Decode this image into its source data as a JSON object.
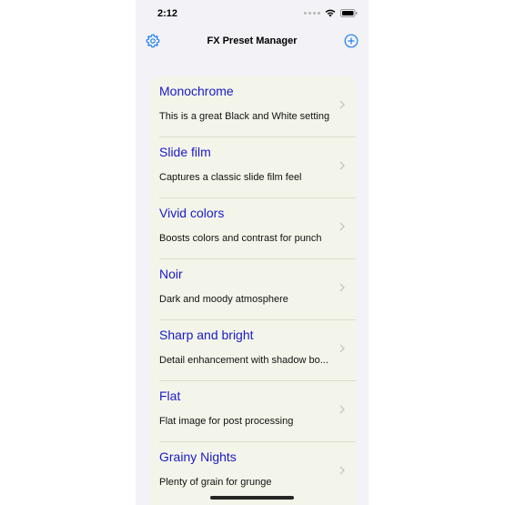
{
  "status": {
    "time": "2:12"
  },
  "nav": {
    "title": "FX Preset Manager",
    "settings_icon": "gear-icon",
    "add_icon": "plus-circle-icon"
  },
  "colors": {
    "accent": "#1a7ff0",
    "title_text": "#1a1ac8",
    "list_bg": "#f4f5ea"
  },
  "presets": [
    {
      "title": "Monochrome",
      "subtitle": "This is a great Black and White setting"
    },
    {
      "title": "Slide film",
      "subtitle": "Captures a classic slide film feel"
    },
    {
      "title": "Vivid colors",
      "subtitle": "Boosts colors and contrast for punch"
    },
    {
      "title": "Noir",
      "subtitle": "Dark and moody atmosphere"
    },
    {
      "title": "Sharp and bright",
      "subtitle": "Detail enhancement with shadow bo..."
    },
    {
      "title": "Flat",
      "subtitle": "Flat image for post processing"
    },
    {
      "title": "Grainy Nights",
      "subtitle": "Plenty of grain for grunge"
    }
  ]
}
